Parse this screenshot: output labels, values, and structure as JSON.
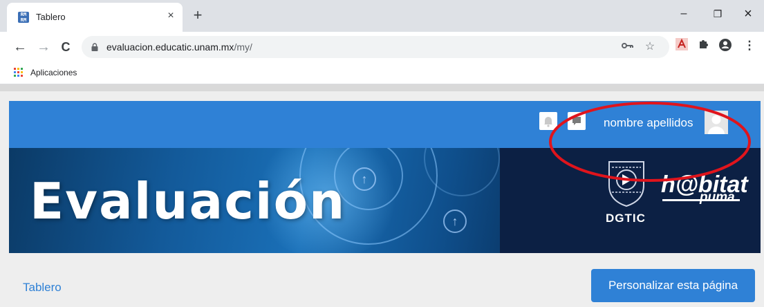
{
  "browser": {
    "tab": {
      "title": "Tablero",
      "close_glyph": "×",
      "favicon": "moodle-favicon"
    },
    "new_tab_glyph": "+",
    "window_controls": {
      "minimize": "–",
      "restore": "❐",
      "close": "×"
    },
    "nav": {
      "back": "←",
      "forward": "→",
      "reload": "C"
    },
    "address": {
      "domain": "evaluacion.educatic.unam.mx",
      "path": "/my/"
    },
    "omnibox_icons": [
      "key-icon",
      "star-icon"
    ],
    "extensions": [
      "acrobat-extension-icon",
      "puzzle-extensions-icon",
      "profile-icon",
      "menu-kebab-icon"
    ],
    "bookmarks": {
      "apps_label": "Aplicaciones"
    }
  },
  "page": {
    "navbar": {
      "icons": [
        "notifications-bell-icon",
        "messages-icon"
      ],
      "user_name": "nombre apellidos"
    },
    "banner": {
      "title": "Evaluación",
      "logo_left_text": "DGTIC",
      "logo_right_main": "h@bitat",
      "logo_right_sub": "puma"
    },
    "breadcrumb": "Tablero",
    "customize_button": "Personalizar esta página"
  },
  "colors": {
    "navbar": "#2f81d6",
    "link": "#2f81d6",
    "button": "#2f81d6",
    "annotation_ellipse": "#e0141c",
    "banner_dark": "#0c2044"
  }
}
